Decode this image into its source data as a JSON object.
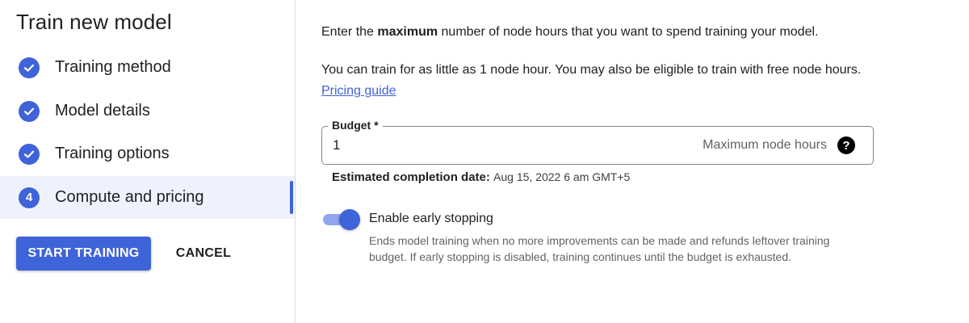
{
  "page_title": "Train new model",
  "steps": [
    {
      "label": "Training method",
      "status": "done"
    },
    {
      "label": "Model details",
      "status": "done"
    },
    {
      "label": "Training options",
      "status": "done"
    },
    {
      "label": "Compute and pricing",
      "status": "active",
      "number": "4"
    }
  ],
  "actions": {
    "start_label": "START TRAINING",
    "cancel_label": "CANCEL"
  },
  "intro": {
    "prefix": "Enter the ",
    "bold": "maximum",
    "suffix": " number of node hours that you want to spend training your model."
  },
  "info": {
    "text": "You can train for as little as 1 node hour. You may also be eligible to train with free node hours. ",
    "link": "Pricing guide"
  },
  "budget": {
    "label": "Budget *",
    "value": "1",
    "suffix": "Maximum node hours",
    "help_icon": "help-circle-icon"
  },
  "completion": {
    "label": "Estimated completion date:",
    "value": "Aug 15, 2022 6 am GMT+5"
  },
  "early_stopping": {
    "enabled": true,
    "label": "Enable early stopping",
    "description": "Ends model training when no more improvements can be made and refunds leftover training budget. If early stopping is disabled, training continues until the budget is exhausted."
  },
  "colors": {
    "accent": "#3f63d8",
    "active_step_bg": "#eff2fd",
    "toggle_track": "#8fa5ec"
  }
}
